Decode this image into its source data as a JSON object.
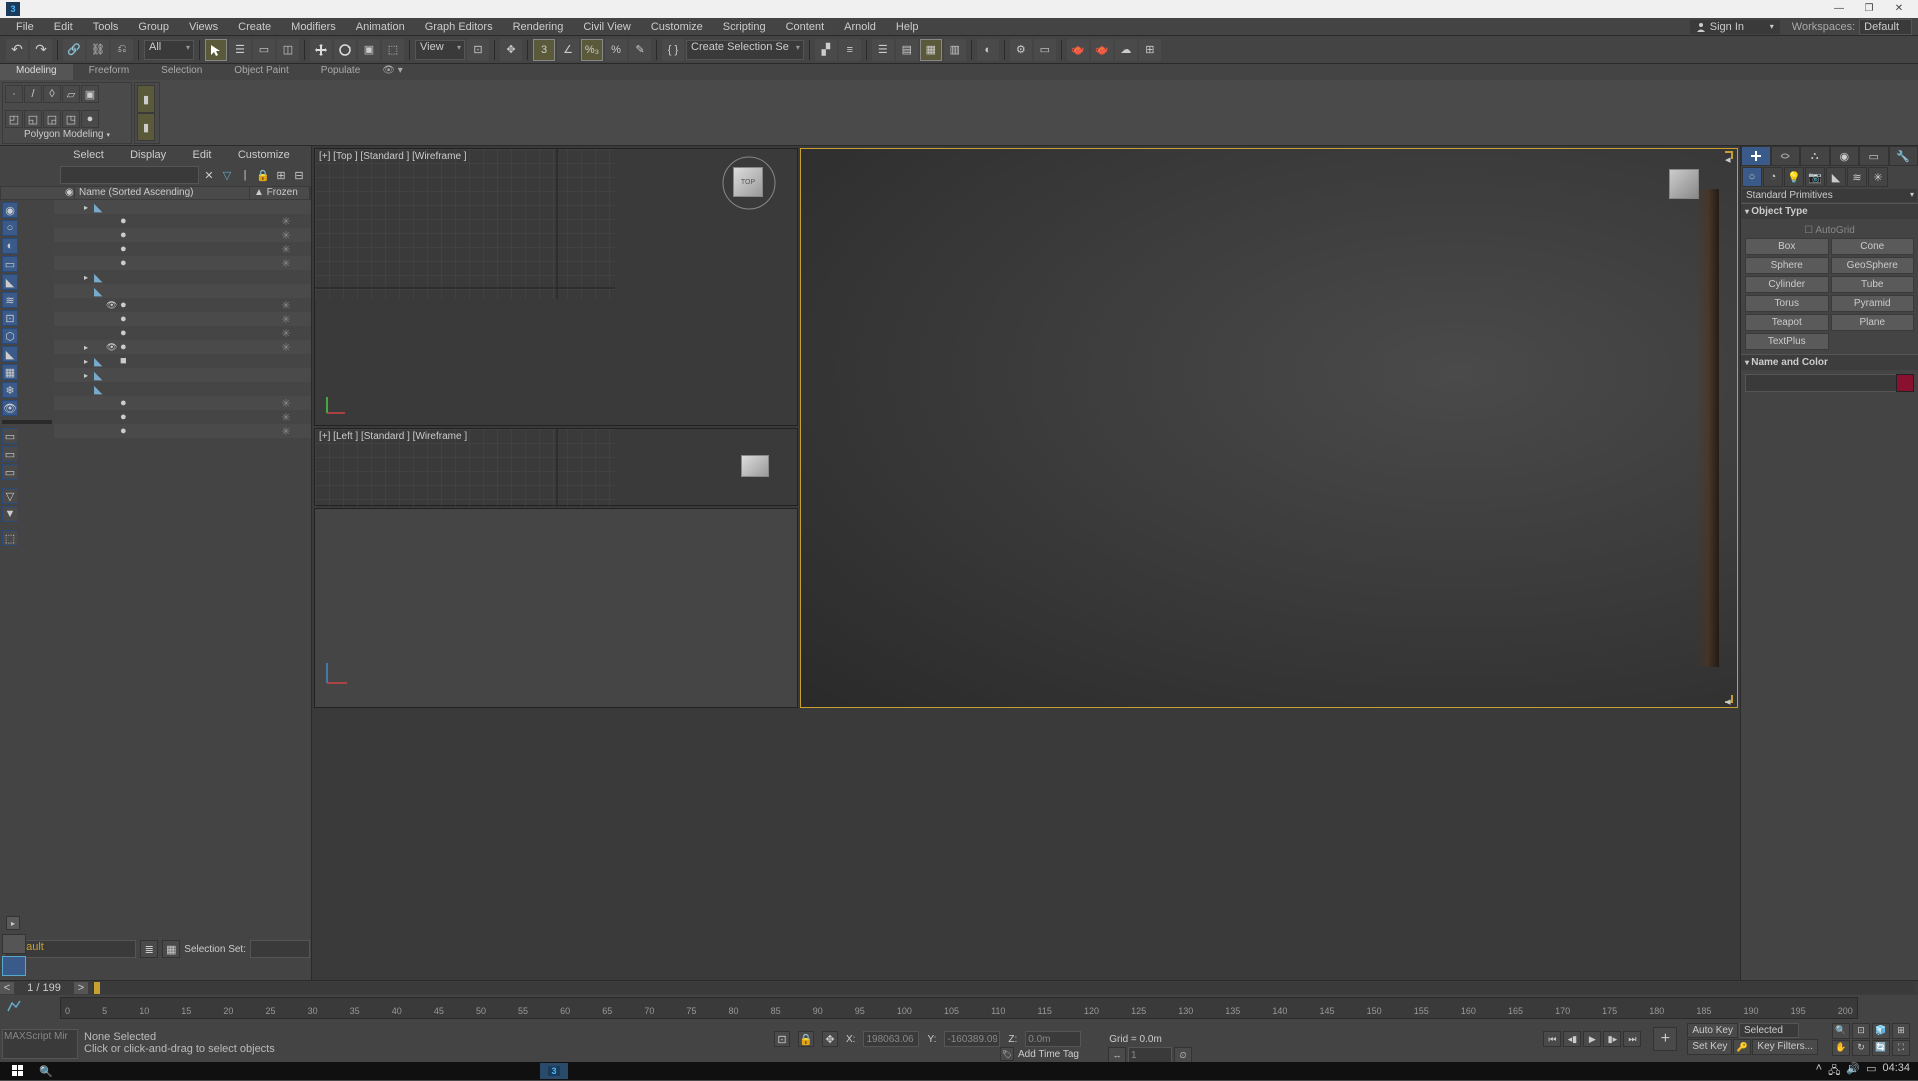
{
  "menubar": {
    "items": [
      "File",
      "Edit",
      "Tools",
      "Group",
      "Views",
      "Create",
      "Modifiers",
      "Animation",
      "Graph Editors",
      "Rendering",
      "Civil View",
      "Customize",
      "Scripting",
      "Content",
      "Arnold",
      "Help"
    ],
    "signin": "Sign In",
    "workspaces_label": "Workspaces:",
    "workspaces_value": "Default"
  },
  "maintoolbar": {
    "filter_all": "All",
    "view_select": "View",
    "create_sel": "Create Selection Se"
  },
  "ribbon": {
    "tabs": [
      "Modeling",
      "Freeform",
      "Selection",
      "Object Paint",
      "Populate"
    ],
    "panel_label": "Polygon Modeling"
  },
  "scene_explorer": {
    "menus": [
      "Select",
      "Display",
      "Edit",
      "Customize"
    ],
    "col_name": "Name (Sorted Ascending)",
    "col_frozen": "▲ Frozen",
    "rows": [
      {
        "exp": "▸",
        "ico": "◣",
        "eye": "",
        "dot": "",
        "frz": ""
      },
      {
        "exp": "",
        "ico": "",
        "eye": "",
        "dot": "●",
        "frz": "✳"
      },
      {
        "exp": "",
        "ico": "",
        "eye": "",
        "dot": "●",
        "frz": "✳"
      },
      {
        "exp": "",
        "ico": "",
        "eye": "",
        "dot": "●",
        "frz": "✳"
      },
      {
        "exp": "",
        "ico": "",
        "eye": "",
        "dot": "●",
        "frz": "✳"
      },
      {
        "exp": "▸",
        "ico": "◣",
        "eye": "",
        "dot": "",
        "frz": ""
      },
      {
        "exp": "",
        "ico": "◣",
        "eye": "",
        "dot": "",
        "frz": ""
      },
      {
        "exp": "",
        "ico": "",
        "eye": "👁",
        "dot": "●",
        "frz": "✳"
      },
      {
        "exp": "",
        "ico": "",
        "eye": "",
        "dot": "●",
        "frz": "✳"
      },
      {
        "exp": "",
        "ico": "",
        "eye": "",
        "dot": "●",
        "frz": "✳"
      },
      {
        "exp": "▸",
        "ico": "",
        "eye": "👁",
        "dot": "●",
        "frz": "✳"
      },
      {
        "exp": "▸",
        "ico": "◣",
        "eye": "",
        "dot": "■",
        "frz": ""
      },
      {
        "exp": "▸",
        "ico": "◣",
        "eye": "",
        "dot": "",
        "frz": ""
      },
      {
        "exp": "",
        "ico": "◣",
        "eye": "",
        "dot": "",
        "frz": ""
      },
      {
        "exp": "",
        "ico": "",
        "eye": "",
        "dot": "●",
        "frz": "✳"
      },
      {
        "exp": "",
        "ico": "",
        "eye": "",
        "dot": "●",
        "frz": "✳"
      },
      {
        "exp": "",
        "ico": "",
        "eye": "",
        "dot": "●",
        "frz": "✳"
      }
    ]
  },
  "bottom_left": {
    "layer": "Default",
    "selset": "Selection Set:"
  },
  "viewports": {
    "top_label": "[+] [Top ] [Standard ] [Wireframe ]",
    "left_label": "[+] [Left ] [Standard ] [Wireframe ]"
  },
  "command_panel": {
    "dropdown": "Standard Primitives",
    "rollout1": "Object Type",
    "autogrid": "AutoGrid",
    "buttons": [
      "Box",
      "Cone",
      "Sphere",
      "GeoSphere",
      "Cylinder",
      "Tube",
      "Torus",
      "Pyramid",
      "Teapot",
      "Plane",
      "TextPlus",
      ""
    ],
    "rollout2": "Name and Color"
  },
  "bottom": {
    "frame": "1 / 199",
    "ticks": [
      "0",
      "5",
      "10",
      "15",
      "20",
      "25",
      "30",
      "35",
      "40",
      "45",
      "50",
      "55",
      "60",
      "65",
      "70",
      "75",
      "80",
      "85",
      "90",
      "95",
      "100",
      "105",
      "110",
      "115",
      "120",
      "125",
      "130",
      "135",
      "140",
      "145",
      "150",
      "155",
      "160",
      "165",
      "170",
      "175",
      "180",
      "185",
      "190",
      "195",
      "200"
    ],
    "selected": "None Selected",
    "prompt": "Click or click-and-drag to select objects",
    "x_label": "X:",
    "x_val": "198063.06",
    "y_label": "Y:",
    "y_val": "-160389.09",
    "z_label": "Z:",
    "z_val": "0.0m",
    "grid": "Grid = 0.0m",
    "addtag": "Add Time Tag",
    "autokey": "Auto Key",
    "autokey_sel": "Selected",
    "setkey": "Set Key",
    "keyfilters": "Key Filters...",
    "frame_input": "1",
    "maxscript": "MAXScript Mir"
  },
  "taskbar": {
    "time": "04:34"
  }
}
